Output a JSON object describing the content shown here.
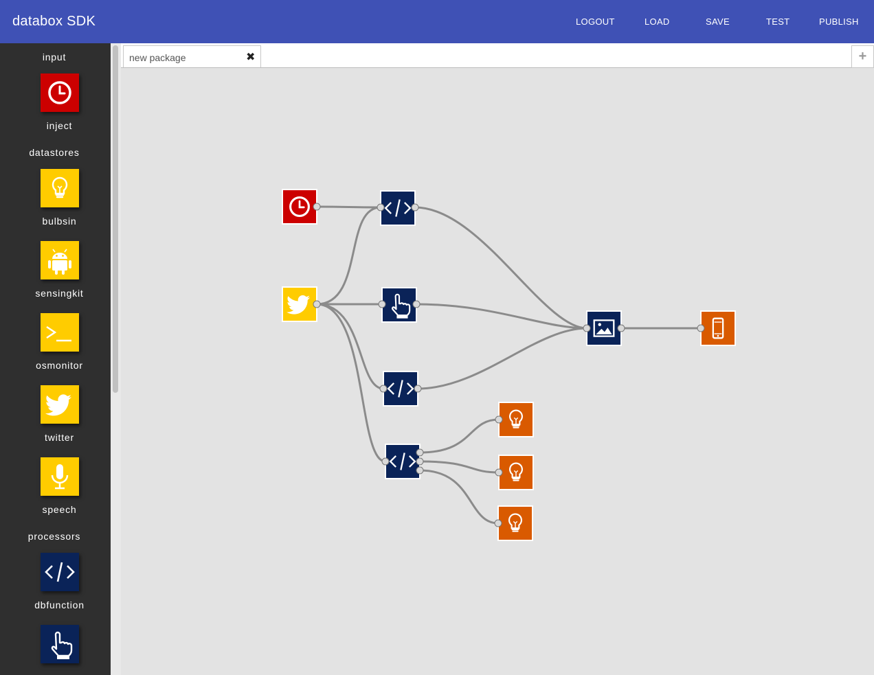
{
  "app": {
    "title": "databox SDK"
  },
  "nav": {
    "logout": "LOGOUT",
    "load": "LOAD",
    "save": "SAVE",
    "test": "TEST",
    "publish": "PUBLISH"
  },
  "sidebar": {
    "categories": {
      "input": "input",
      "datastores": "datastores",
      "processors": "processors"
    },
    "items": [
      {
        "label": "inject",
        "icon": "clock-icon",
        "color": "#cc0000"
      },
      {
        "label": "bulbsin",
        "icon": "lightbulb-icon",
        "color": "#ffcc00"
      },
      {
        "label": "sensingkit",
        "icon": "android-icon",
        "color": "#ffcc00"
      },
      {
        "label": "osmonitor",
        "icon": "terminal-icon",
        "color": "#ffcc00"
      },
      {
        "label": "twitter",
        "icon": "twitter-bird-icon",
        "color": "#ffcc00"
      },
      {
        "label": "speech",
        "icon": "microphone-icon",
        "color": "#ffcc00"
      },
      {
        "label": "dbfunction",
        "icon": "code-icon",
        "color": "#0a2358"
      },
      {
        "label": "",
        "icon": "hand-pointer-icon",
        "color": "#0a2358"
      }
    ]
  },
  "tabs": {
    "active": "new package",
    "close_icon": "close-icon",
    "add_icon": "plus-icon"
  },
  "colors": {
    "appbar": "#3f51b5",
    "sidebar": "#2f2f2f",
    "canvas": "#e3e3e3",
    "input": "#cc0000",
    "datastore": "#ffcc00",
    "processor": "#0a2358",
    "output": "#d95a00"
  },
  "flow": {
    "nodes": [
      {
        "id": "inject-node",
        "icon": "clock-icon",
        "type": "input"
      },
      {
        "id": "twitter-node",
        "icon": "twitter-bird-icon",
        "type": "datastore"
      },
      {
        "id": "function-node-1",
        "icon": "code-icon",
        "type": "processor"
      },
      {
        "id": "pointer-node",
        "icon": "hand-pointer-icon",
        "type": "processor"
      },
      {
        "id": "function-node-2",
        "icon": "code-icon",
        "type": "processor"
      },
      {
        "id": "function-node-3",
        "icon": "code-icon",
        "type": "processor"
      },
      {
        "id": "image-node",
        "icon": "image-icon",
        "type": "processor"
      },
      {
        "id": "app-node",
        "icon": "mobile-phone-icon",
        "type": "output"
      },
      {
        "id": "bulb-node-1",
        "icon": "lightbulb-icon",
        "type": "output"
      },
      {
        "id": "bulb-node-2",
        "icon": "lightbulb-icon",
        "type": "output"
      },
      {
        "id": "bulb-node-3",
        "icon": "lightbulb-icon",
        "type": "output"
      }
    ],
    "connections": [
      [
        "inject-node",
        "function-node-1"
      ],
      [
        "twitter-node",
        "function-node-1"
      ],
      [
        "twitter-node",
        "pointer-node"
      ],
      [
        "twitter-node",
        "function-node-2"
      ],
      [
        "twitter-node",
        "function-node-3"
      ],
      [
        "function-node-1",
        "image-node"
      ],
      [
        "pointer-node",
        "image-node"
      ],
      [
        "function-node-2",
        "image-node"
      ],
      [
        "image-node",
        "app-node"
      ],
      [
        "function-node-3",
        "bulb-node-1"
      ],
      [
        "function-node-3",
        "bulb-node-2"
      ],
      [
        "function-node-3",
        "bulb-node-3"
      ]
    ]
  }
}
